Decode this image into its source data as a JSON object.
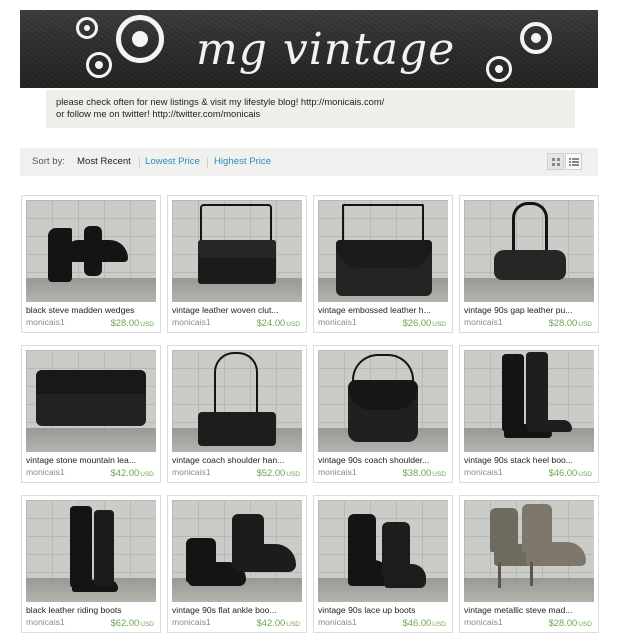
{
  "banner": {
    "title": "mg vintage"
  },
  "notice": {
    "line1": "please check often for new listings & visit my lifestyle blog! http://monicais.com/",
    "line2": "or follow me on twitter! http://twitter.com/monicais"
  },
  "sort": {
    "label": "Sort by:",
    "options": [
      "Most Recent",
      "Lowest Price",
      "Highest Price"
    ],
    "active": "Most Recent"
  },
  "view": {
    "modes": [
      "grid-view-icon",
      "list-view-icon"
    ],
    "active": "grid"
  },
  "colors": {
    "price": "#6aa84f",
    "link": "#2b8fbf"
  },
  "listings": [
    {
      "title": "black steve madden wedges",
      "seller": "monicais1",
      "price": "$28.00",
      "currency": "USD"
    },
    {
      "title": "vintage leather woven clut...",
      "seller": "monicais1",
      "price": "$24.00",
      "currency": "USD"
    },
    {
      "title": "vintage embossed leather h...",
      "seller": "monicais1",
      "price": "$26.00",
      "currency": "USD"
    },
    {
      "title": "vintage 90s gap leather pu...",
      "seller": "monicais1",
      "price": "$28.00",
      "currency": "USD"
    },
    {
      "title": "vintage stone mountain lea...",
      "seller": "monicais1",
      "price": "$42.00",
      "currency": "USD"
    },
    {
      "title": "vintage coach shoulder han...",
      "seller": "monicais1",
      "price": "$52.00",
      "currency": "USD"
    },
    {
      "title": "vintage 90s coach shoulder...",
      "seller": "monicais1",
      "price": "$38.00",
      "currency": "USD"
    },
    {
      "title": "vintage 90s stack heel boo...",
      "seller": "monicais1",
      "price": "$46.00",
      "currency": "USD"
    },
    {
      "title": "black leather riding boots",
      "seller": "monicais1",
      "price": "$62.00",
      "currency": "USD"
    },
    {
      "title": "vintage 90s flat ankle boo...",
      "seller": "monicais1",
      "price": "$42.00",
      "currency": "USD"
    },
    {
      "title": "vintage 90s lace up boots",
      "seller": "monicais1",
      "price": "$46.00",
      "currency": "USD"
    },
    {
      "title": "vintage metallic steve mad...",
      "seller": "monicais1",
      "price": "$28.00",
      "currency": "USD"
    }
  ]
}
